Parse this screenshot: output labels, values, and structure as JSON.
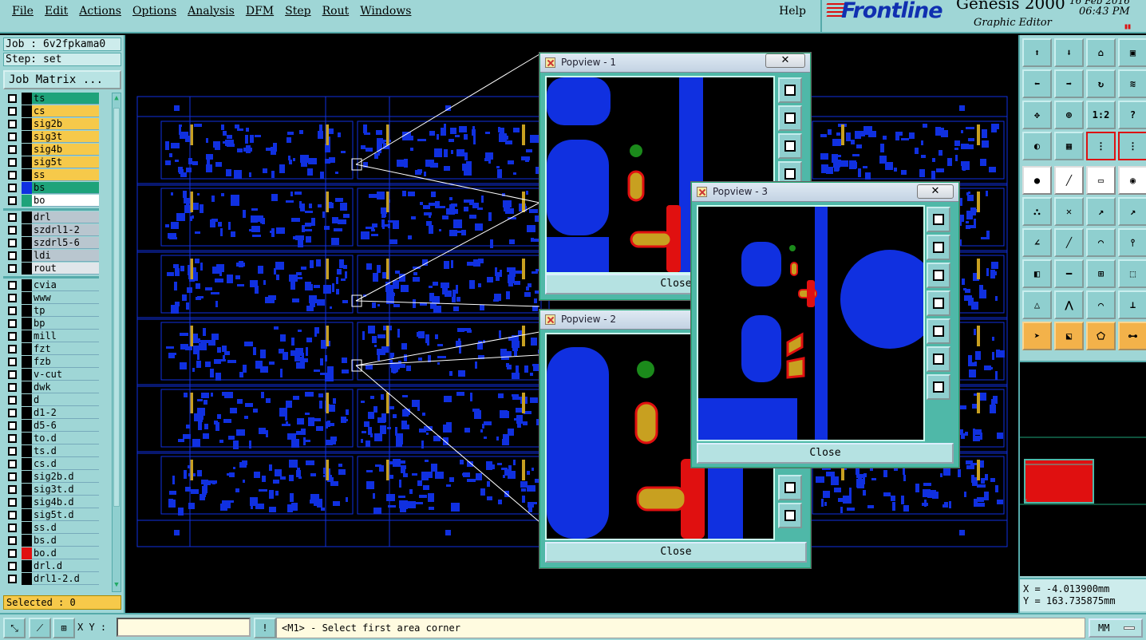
{
  "menu": {
    "items": [
      "File",
      "Edit",
      "Actions",
      "Options",
      "Analysis",
      "DFM",
      "Step",
      "Rout",
      "Windows"
    ],
    "help": "Help"
  },
  "brand": {
    "logo": "Frontline",
    "product": "Genesis 2000",
    "subtitle": "Graphic Editor",
    "date": "16 Feb 2016",
    "time": "06:43 PM"
  },
  "job": {
    "job_label": "Job : 6v2fpkama0",
    "step_label": "Step: set",
    "matrix_button": "Job Matrix ..."
  },
  "layers": {
    "group1": [
      {
        "name": "ts",
        "color": "#1ea37a",
        "swatch": "#000000"
      },
      {
        "name": "cs",
        "color": "#f6c94a",
        "swatch": "#000000"
      },
      {
        "name": "sig2b",
        "color": "#f6c94a",
        "swatch": "#000000"
      },
      {
        "name": "sig3t",
        "color": "#f6c94a",
        "swatch": "#000000"
      },
      {
        "name": "sig4b",
        "color": "#f6c94a",
        "swatch": "#000000"
      },
      {
        "name": "sig5t",
        "color": "#f6c94a",
        "swatch": "#000000"
      },
      {
        "name": "ss",
        "color": "#f6c94a",
        "swatch": "#000000"
      },
      {
        "name": "bs",
        "color": "#1ea37a",
        "swatch": "#1030e0"
      },
      {
        "name": "bo",
        "color": "#ffffff",
        "swatch": "#1ea37a"
      }
    ],
    "group2": [
      {
        "name": "drl",
        "color": "#b9c6cf",
        "swatch": "#000000"
      },
      {
        "name": "szdrl1-2",
        "color": "#b9c6cf",
        "swatch": "#000000"
      },
      {
        "name": "szdrl5-6",
        "color": "#b9c6cf",
        "swatch": "#000000"
      },
      {
        "name": "ldi",
        "color": "#b9c6cf",
        "swatch": "#000000"
      },
      {
        "name": "rout",
        "color": "#e0e6ea",
        "swatch": "#000000"
      }
    ],
    "group3": [
      {
        "name": "cvia",
        "color": "#9fd6d6",
        "swatch": "#000000"
      },
      {
        "name": "www",
        "color": "#9fd6d6",
        "swatch": "#000000"
      },
      {
        "name": "tp",
        "color": "#9fd6d6",
        "swatch": "#000000"
      },
      {
        "name": "bp",
        "color": "#9fd6d6",
        "swatch": "#000000"
      },
      {
        "name": "mill",
        "color": "#9fd6d6",
        "swatch": "#000000"
      },
      {
        "name": "fzt",
        "color": "#9fd6d6",
        "swatch": "#000000"
      },
      {
        "name": "fzb",
        "color": "#9fd6d6",
        "swatch": "#000000"
      },
      {
        "name": "v-cut",
        "color": "#9fd6d6",
        "swatch": "#000000"
      },
      {
        "name": "dwk",
        "color": "#9fd6d6",
        "swatch": "#000000"
      },
      {
        "name": "d",
        "color": "#9fd6d6",
        "swatch": "#000000"
      },
      {
        "name": "d1-2",
        "color": "#9fd6d6",
        "swatch": "#000000"
      },
      {
        "name": "d5-6",
        "color": "#9fd6d6",
        "swatch": "#000000"
      },
      {
        "name": "to.d",
        "color": "#9fd6d6",
        "swatch": "#000000"
      },
      {
        "name": "ts.d",
        "color": "#9fd6d6",
        "swatch": "#000000"
      },
      {
        "name": "cs.d",
        "color": "#9fd6d6",
        "swatch": "#000000"
      },
      {
        "name": "sig2b.d",
        "color": "#9fd6d6",
        "swatch": "#000000"
      },
      {
        "name": "sig3t.d",
        "color": "#9fd6d6",
        "swatch": "#000000"
      },
      {
        "name": "sig4b.d",
        "color": "#9fd6d6",
        "swatch": "#000000"
      },
      {
        "name": "sig5t.d",
        "color": "#9fd6d6",
        "swatch": "#000000"
      },
      {
        "name": "ss.d",
        "color": "#9fd6d6",
        "swatch": "#000000"
      },
      {
        "name": "bs.d",
        "color": "#9fd6d6",
        "swatch": "#000000"
      },
      {
        "name": "bo.d",
        "color": "#9fd6d6",
        "swatch": "#e01010"
      },
      {
        "name": "drl.d",
        "color": "#9fd6d6",
        "swatch": "#000000"
      },
      {
        "name": "drl1-2.d",
        "color": "#9fd6d6",
        "swatch": "#000000"
      }
    ]
  },
  "selected": "Selected : 0",
  "popviews": {
    "pv1": {
      "title": "Popview - 1",
      "close_x": "✕",
      "close": "Close"
    },
    "pv2": {
      "title": "Popview - 2",
      "close_x": "✕",
      "close": "Close"
    },
    "pv3": {
      "title": "Popview - 3",
      "close_x": "✕",
      "close": "Close"
    }
  },
  "toolbox": {
    "scale_label": "1:2",
    "help_label": "?"
  },
  "coords": {
    "x": "X = -4.013900mm",
    "y": "Y = 163.735875mm"
  },
  "status": {
    "xy_label": "X Y :",
    "xy_value": "",
    "alert": "!",
    "message": "<M1> - Select first area corner",
    "units": "MM"
  },
  "colors": {
    "panel": "#9fd6d6",
    "copper": "#1030e0",
    "highlight": "#e01010",
    "overlay": "#c8a020",
    "accent": "#1030b0"
  },
  "icons": {
    "stripes": "frontline-stripes-logo",
    "pause": "pause-icon"
  }
}
